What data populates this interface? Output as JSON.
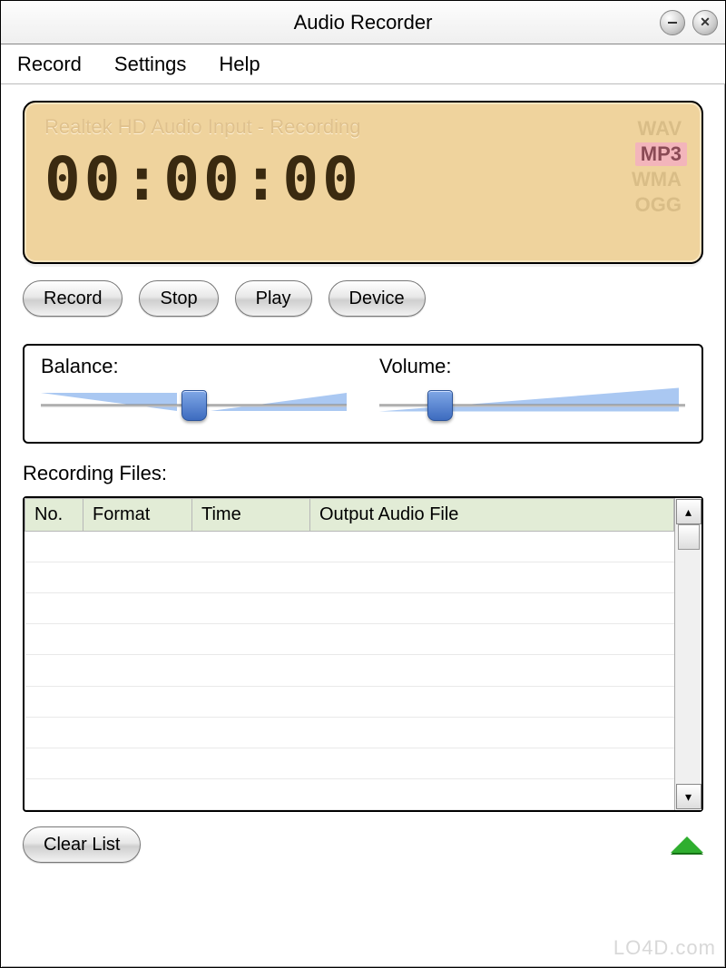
{
  "window": {
    "title": "Audio Recorder"
  },
  "menubar": {
    "record": "Record",
    "settings": "Settings",
    "help": "Help"
  },
  "lcd": {
    "status": "Realtek HD Audio Input - Recording",
    "time": "00:00:00",
    "formats": {
      "wav": "WAV",
      "mp3": "MP3",
      "wma": "WMA",
      "ogg": "OGG",
      "selected": "mp3"
    }
  },
  "buttons": {
    "record": "Record",
    "stop": "Stop",
    "play": "Play",
    "device": "Device",
    "clear_list": "Clear List"
  },
  "sliders": {
    "balance": {
      "label": "Balance:",
      "value": 50
    },
    "volume": {
      "label": "Volume:",
      "value": 20
    }
  },
  "files": {
    "label": "Recording Files:",
    "columns": {
      "no": "No.",
      "format": "Format",
      "time": "Time",
      "output": "Output Audio File"
    },
    "rows": []
  },
  "watermark": "LO4D.com"
}
